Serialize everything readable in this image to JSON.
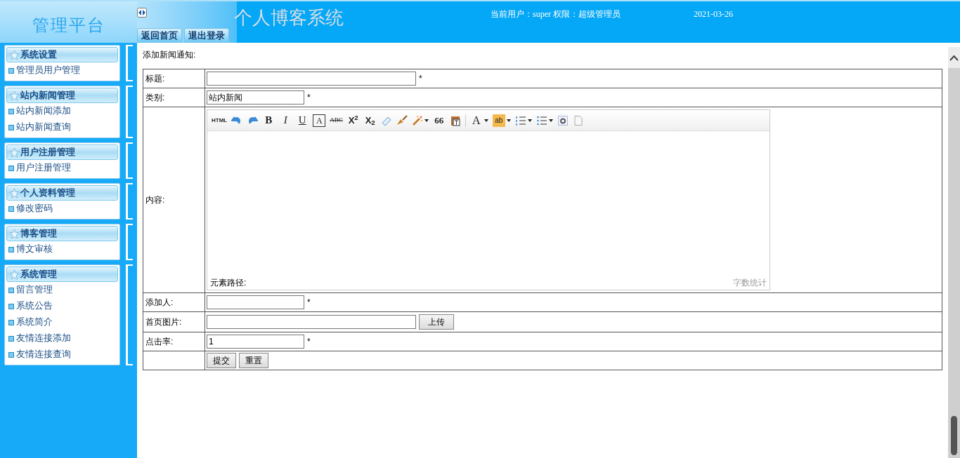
{
  "header": {
    "brand": "管理平台",
    "system_title": "个人博客系统",
    "user_info": "当前用户：super 权限：超级管理员",
    "date": "2021-03-26",
    "tabs": [
      {
        "label": "返回首页"
      },
      {
        "label": "退出登录"
      }
    ]
  },
  "sidebar": {
    "groups": [
      {
        "title": "系统设置",
        "items": [
          "管理员用户管理"
        ]
      },
      {
        "title": "站内新闻管理",
        "items": [
          "站内新闻添加",
          "站内新闻查询"
        ]
      },
      {
        "title": "用户注册管理",
        "items": [
          "用户注册管理"
        ]
      },
      {
        "title": "个人资料管理",
        "items": [
          "修改密码"
        ]
      },
      {
        "title": "博客管理",
        "items": [
          "博文审核"
        ]
      },
      {
        "title": "系统管理",
        "items": [
          "留言管理",
          "系统公告",
          "系统简介",
          "友情连接添加",
          "友情连接查询"
        ]
      }
    ]
  },
  "form": {
    "heading": "添加新闻通知:",
    "rows": [
      {
        "kind": "input",
        "label": "标题:",
        "value": "",
        "wide": true,
        "required": "*"
      },
      {
        "kind": "input",
        "label": "类别:",
        "value": "站内新闻",
        "wide": false,
        "required": "*"
      },
      {
        "kind": "editor",
        "label": "内容:"
      },
      {
        "kind": "input",
        "label": "添加人:",
        "value": "",
        "wide": false,
        "required": "*"
      },
      {
        "kind": "upload",
        "label": "首页图片:",
        "value": "",
        "button": "上传"
      },
      {
        "kind": "input",
        "label": "点击率:",
        "value": "1",
        "wide": false,
        "required": "*"
      },
      {
        "kind": "buttons",
        "buttons": [
          "提交",
          "重置"
        ]
      }
    ]
  },
  "editor": {
    "labels": {
      "html": "HTML",
      "bold": "B",
      "italic": "I",
      "underline": "U",
      "boxed": "A",
      "strike": "ABC",
      "sup": "X$^{2}$",
      "sub": "X$_{2}$",
      "quote": "66",
      "font_color": "A",
      "highlight": "ab"
    },
    "path": "元素路径:",
    "word_count": "字数统计"
  }
}
